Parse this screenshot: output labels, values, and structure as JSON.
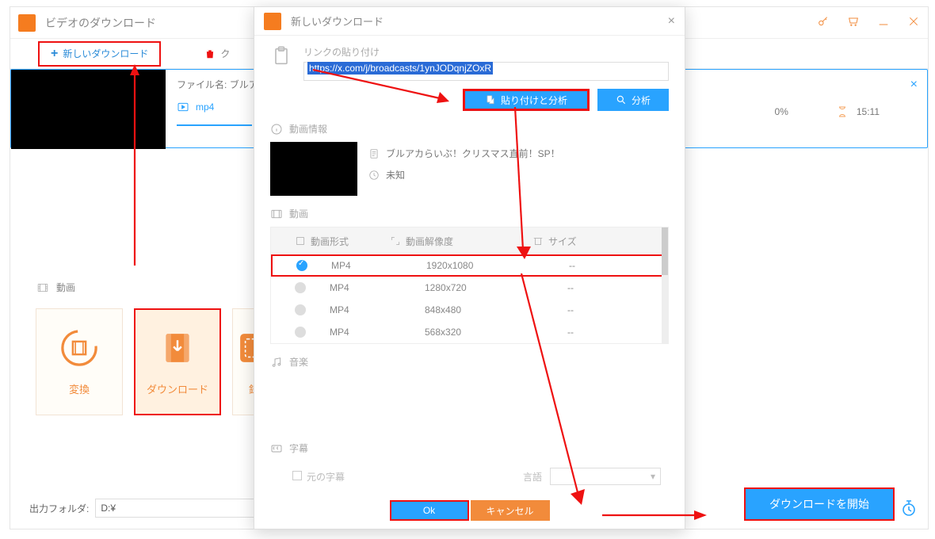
{
  "window": {
    "title": "ビデオのダウンロード"
  },
  "toolbar": {
    "new_download": "新しいダウンロード",
    "clear": "ク"
  },
  "queue": {
    "file_label": "ファイル名:",
    "file_name": "ブルアカ",
    "format": "mp4",
    "percent": "0%",
    "duration": "15:11"
  },
  "section": {
    "video_label": "動画"
  },
  "cards": {
    "convert": "変換",
    "download": "ダウンロード",
    "record": "録"
  },
  "output": {
    "label": "出力フォルダ:",
    "path": "D:¥"
  },
  "start_button": "ダウンロードを開始",
  "dialog": {
    "title": "新しいダウンロード",
    "link_label": "リンクの貼り付け",
    "link_value": "https://x.com/j/broadcasts/1ynJODqnjZOxR",
    "paste_analyze": "貼り付けと分析",
    "analyze": "分析",
    "video_info_label": "動画情報",
    "video_title": "ブルアカらいぶ！クリスマス直前！SP！",
    "video_status": "未知",
    "video_section": "動画",
    "col_format": "動画形式",
    "col_resolution": "動画解像度",
    "col_size": "サイズ",
    "formats": [
      {
        "fmt": "MP4",
        "res": "1920x1080",
        "size": "--",
        "selected": true
      },
      {
        "fmt": "MP4",
        "res": "1280x720",
        "size": "--",
        "selected": false
      },
      {
        "fmt": "MP4",
        "res": "848x480",
        "size": "--",
        "selected": false
      },
      {
        "fmt": "MP4",
        "res": "568x320",
        "size": "--",
        "selected": false
      }
    ],
    "audio_label": "音楽",
    "subtitle_label": "字幕",
    "original_sub": "元の字幕",
    "language_label": "言語",
    "ok": "Ok",
    "cancel": "キャンセル"
  }
}
